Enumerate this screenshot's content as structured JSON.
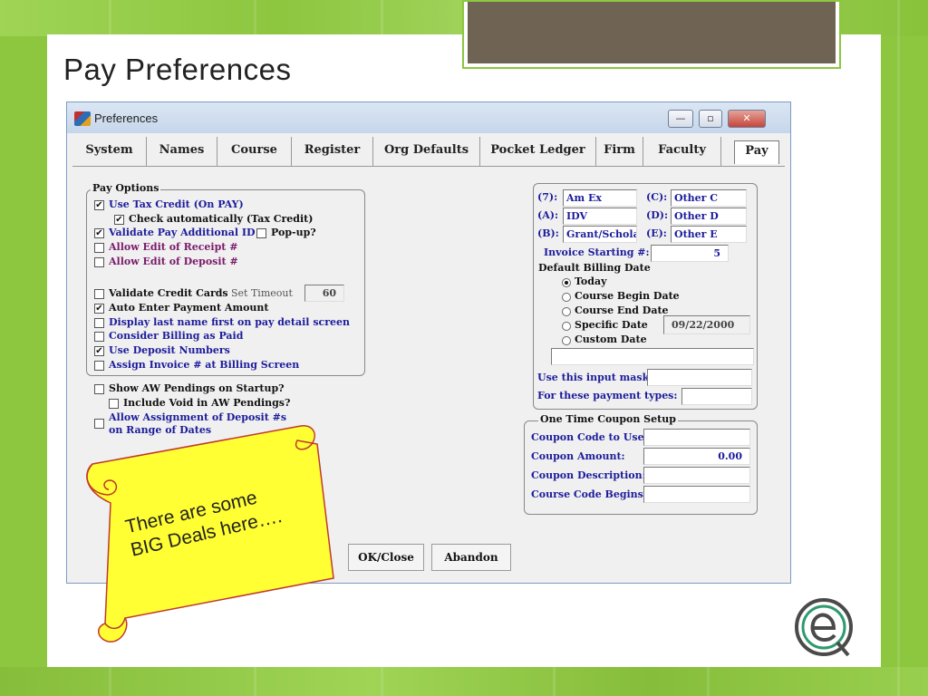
{
  "slide": {
    "title": "Pay Preferences"
  },
  "window": {
    "title": "Preferences",
    "controls": {
      "minimize": "—",
      "maximize": "▫",
      "close": "✕"
    }
  },
  "tabs": [
    {
      "label": "System",
      "active": false
    },
    {
      "label": "Names",
      "active": false
    },
    {
      "label": "Course",
      "active": false
    },
    {
      "label": "Register",
      "active": false
    },
    {
      "label": "Org Defaults",
      "active": false
    },
    {
      "label": "Pocket Ledger",
      "active": false
    },
    {
      "label": "Firm",
      "active": false
    },
    {
      "label": "Faculty",
      "active": false
    },
    {
      "label": "Pay",
      "active": true
    }
  ],
  "pay_options": {
    "group_title": "Pay Options",
    "use_tax_credit": {
      "label": "Use Tax Credit (On PAY)",
      "checked": "✔"
    },
    "check_auto": {
      "label": "Check automatically (Tax Credit)",
      "checked": "✔"
    },
    "validate_pay_id": {
      "label": "Validate Pay Additional ID",
      "checked": "✔"
    },
    "popup": {
      "label": "Pop-up?",
      "checked": ""
    },
    "allow_edit_receipt": {
      "label": "Allow Edit of Receipt #",
      "checked": ""
    },
    "allow_edit_deposit": {
      "label": "Allow Edit of Deposit #",
      "checked": ""
    },
    "validate_cc": {
      "label": "Validate Credit Cards",
      "checked": ""
    },
    "set_timeout_label": "Set Timeout",
    "set_timeout_value": "60",
    "auto_enter": {
      "label": "Auto Enter Payment Amount",
      "checked": "✔"
    },
    "display_last": {
      "label": "Display last name first on pay detail screen",
      "checked": ""
    },
    "consider_billing": {
      "label": "Consider Billing as Paid",
      "checked": ""
    },
    "use_deposit": {
      "label": "Use Deposit Numbers",
      "checked": "✔"
    },
    "assign_invoice": {
      "label": "Assign Invoice # at Billing Screen",
      "checked": ""
    }
  },
  "other_options": {
    "show_aw": {
      "label": "Show AW Pendings on Startup?",
      "checked": ""
    },
    "include_void": {
      "label": "Include Void in AW Pendings?",
      "checked": ""
    },
    "allow_assign": {
      "label1": "Allow Assignment of Deposit #s",
      "label2": "on Range of Dates",
      "checked": ""
    }
  },
  "payment_types": {
    "t7": {
      "label": "(7):",
      "value": "Am Ex"
    },
    "tc": {
      "label": "(C):",
      "value": "Other C"
    },
    "ta": {
      "label": "(A):",
      "value": "IDV"
    },
    "td": {
      "label": "(D):",
      "value": "Other D"
    },
    "tb": {
      "label": "(B):",
      "value": "Grant/Schola"
    },
    "te": {
      "label": "(E):",
      "value": "Other E"
    },
    "invoice_label": "Invoice Starting #:",
    "invoice_value": "5",
    "billing_label": "Default Billing Date",
    "billing_options": [
      {
        "label": "Today",
        "selected": true
      },
      {
        "label": "Course Begin Date",
        "selected": false
      },
      {
        "label": "Course End Date",
        "selected": false
      },
      {
        "label": "Specific Date",
        "selected": false
      },
      {
        "label": "Custom Date",
        "selected": false
      }
    ],
    "specific_date_value": "09/22/2000",
    "mask_label": "Use this input mask:",
    "mask_value": "",
    "types_label": "For these payment types:",
    "types_value": ""
  },
  "coupon": {
    "group_title": "One Time Coupon Setup",
    "code_label": "Coupon Code to Use:",
    "code_value": "",
    "amount_label": "Coupon Amount:",
    "amount_value": "0.00",
    "desc_label": "Coupon Description:",
    "desc_value": "",
    "course_label": "Course Code Begins:",
    "course_value": ""
  },
  "buttons": {
    "ok": "OK/Close",
    "abandon": "Abandon"
  },
  "note": {
    "text": "There are some\nBIG Deals here…."
  },
  "colors": {
    "background": "#8dc63f",
    "label_blue": "#1c1c9c",
    "label_purple": "#7a1a6a",
    "scroll_yellow": "#ffff33",
    "scroll_outline": "#c0392b"
  }
}
